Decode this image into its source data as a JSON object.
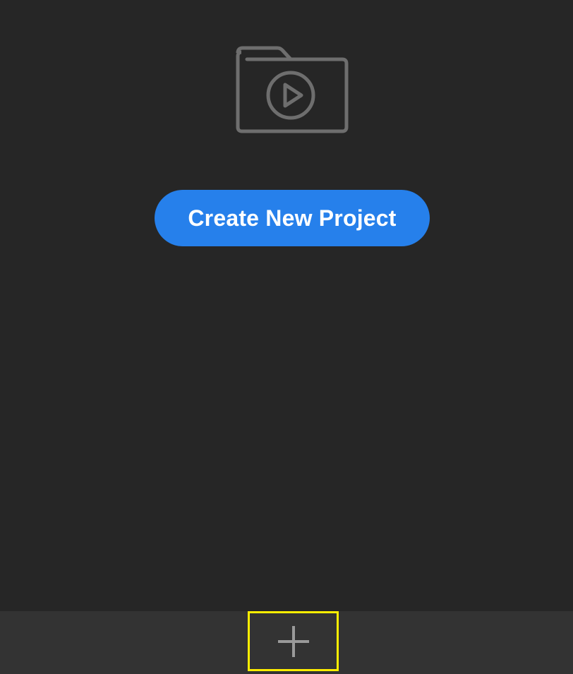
{
  "empty_state": {
    "icon": "folder-play-icon",
    "create_button_label": "Create New Project"
  },
  "bottom_bar": {
    "add_icon": "plus-icon"
  },
  "colors": {
    "background": "#262626",
    "bottom_bar": "#333333",
    "accent": "#2680eb",
    "icon": "#6e6e6e",
    "highlight": "#ffee00"
  }
}
